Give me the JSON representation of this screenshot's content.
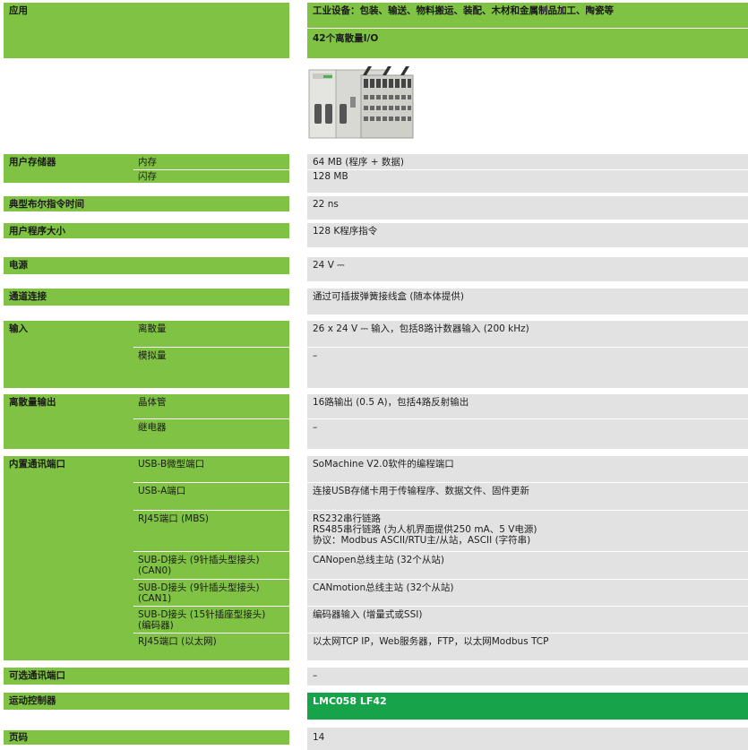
{
  "app": {
    "label": "应用",
    "value1": "工业设备：包装、输送、物料搬运、装配、木材和金属制品加工、陶瓷等",
    "value2": "42个离散量I/O"
  },
  "product_image": {
    "icon": "plc-controller-image"
  },
  "memory": {
    "label": "用户存储器",
    "ram_label": "内存",
    "ram_value": "64 MB (程序 + 数据)",
    "flash_label": "闪存",
    "flash_value": "128 MB"
  },
  "bool_time": {
    "label": "典型布尔指令时间",
    "value": "22 ns"
  },
  "program_size": {
    "label": "用户程序大小",
    "value": "128 K程序指令"
  },
  "power": {
    "label": "电源",
    "value": "24 V ⎓"
  },
  "channel": {
    "label": "通道连接",
    "value": "通过可插拔弹簧接线盒 (随本体提供)"
  },
  "inputs": {
    "label": "输入",
    "discrete_label": "离散量",
    "discrete_value": "26 x 24 V ⎓ 输入，包括8路计数器输入 (200 kHz)",
    "analog_label": "模拟量",
    "analog_value": "–"
  },
  "outputs": {
    "label": "离散量输出",
    "transistor_label": "晶体管",
    "transistor_value": "16路输出 (0.5 A)，包括4路反射输出",
    "relay_label": "继电器",
    "relay_value": "–"
  },
  "comm": {
    "label": "内置通讯端口",
    "usb_b_label": "USB-B微型端口",
    "usb_b_value": "SoMachine V2.0软件的编程端口",
    "usb_a_label": "USB-A端口",
    "usb_a_value": "连接USB存储卡用于传输程序、数据文件、固件更新",
    "rj45_label": "RJ45端口 (MBS)",
    "rj45_value": "RS232串行链路\nRS485串行链路 (为人机界面提供250 mA、5 V电源)\n协议：Modbus ASCII/RTU主/从站，ASCII (字符串)",
    "can0_label": "SUB-D接头 (9针插头型接头)\n(CAN0)",
    "can0_value": "CANopen总线主站 (32个从站)",
    "can1_label": "SUB-D接头 (9针插头型接头)\n(CAN1)",
    "can1_value": "CANmotion总线主站 (32个从站)",
    "enc_label": "SUB-D接头 (15针插座型接头)\n(编码器)",
    "enc_value": "编码器输入 (增量式或SSI)",
    "eth_label": "RJ45端口 (以太网)",
    "eth_value": "以太网TCP IP，Web服务器，FTP，以太网Modbus TCP"
  },
  "optional_comm": {
    "label": "可选通讯端口",
    "value": "–"
  },
  "motion": {
    "label": "运动控制器",
    "value": "LMC058 LF42"
  },
  "page": {
    "label": "页码",
    "value": "14"
  },
  "colors": {
    "green": "#80c243",
    "dark_green": "#16a34a",
    "gray": "#e2e2e2"
  }
}
